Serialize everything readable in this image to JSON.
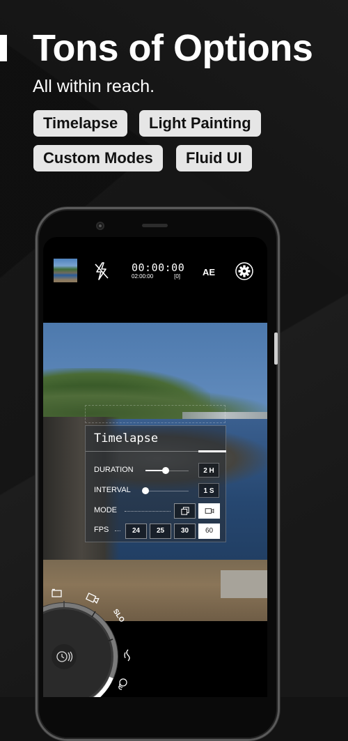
{
  "promo": {
    "headline": "Tons of Options",
    "subhead": "All within reach.",
    "chips": [
      "Timelapse",
      "Light Painting",
      "Custom Modes",
      "Fluid UI"
    ]
  },
  "camera_app": {
    "topbar": {
      "gallery_thumbnail": "last-photo-thumbnail",
      "flash_icon": "flash-off-icon",
      "timer": "00:00:00",
      "timer_total": "02:00:00",
      "frame_count": "[0]",
      "exposure_label": "AE",
      "settings_icon": "gear-icon"
    },
    "timelapse_panel": {
      "title": "Timelapse",
      "duration": {
        "label": "DURATION",
        "value": "2 H",
        "slider_fraction": 0.55
      },
      "interval": {
        "label": "INTERVAL",
        "value": "1 S",
        "slider_fraction": 0.0
      },
      "mode": {
        "label": "MODE",
        "options": [
          "photo-stack-icon",
          "video-icon"
        ],
        "selected": "video-icon"
      },
      "fps": {
        "label": "FPS",
        "options": [
          "24",
          "25",
          "30",
          "60"
        ],
        "selected": "60"
      }
    },
    "mode_dial": {
      "icons": [
        "gallery-icon",
        "video-icon",
        "slo-mo",
        "timelapse-wave-icon",
        "stacked-coin-icon"
      ],
      "slo_label": "SLO",
      "center_icon": "timelapse-icon"
    },
    "colors": {
      "accent": "#ffffff",
      "panel_bg": "#282d34",
      "chip_bg": "#e6e6e6",
      "background": "#131313"
    }
  }
}
